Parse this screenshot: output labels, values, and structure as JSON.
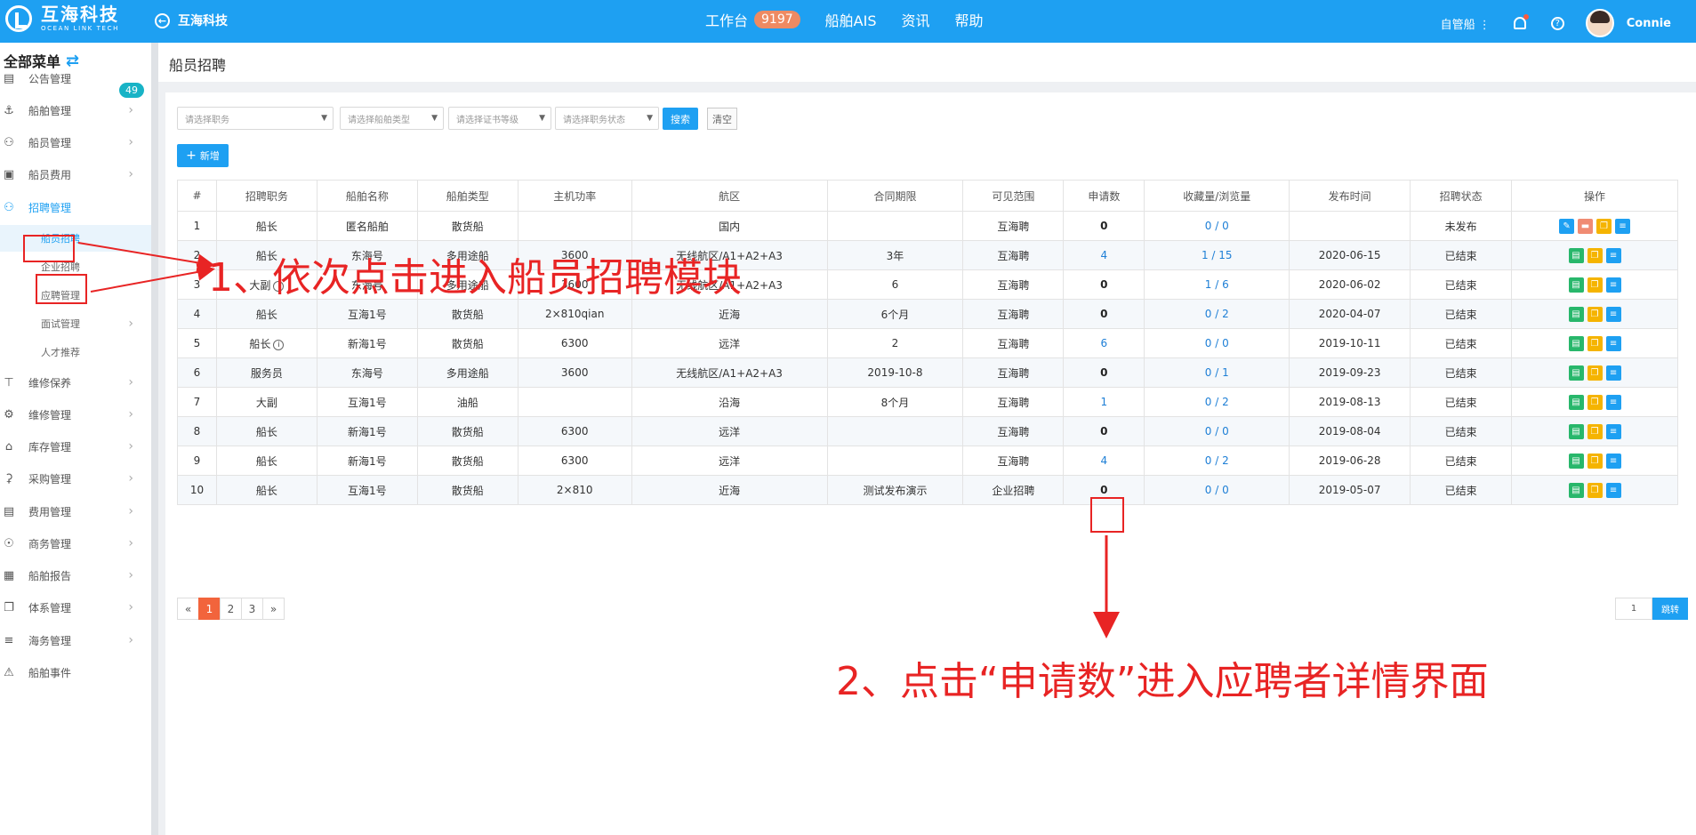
{
  "topbar": {
    "logo_cn": "互海科技",
    "logo_en": "OCEAN LINK TECH",
    "back_label": "互海科技",
    "nav": [
      {
        "label": "工作台",
        "badge": "9197"
      },
      {
        "label": "船舶AIS"
      },
      {
        "label": "资讯"
      },
      {
        "label": "帮助"
      }
    ],
    "owner_label": "自管船",
    "username": "Connie"
  },
  "sidebar": {
    "title": "全部菜单",
    "notice_badge": "49",
    "items": [
      {
        "label": "公告管理",
        "icon": "book-icon"
      },
      {
        "label": "船舶管理",
        "icon": "anchor-icon"
      },
      {
        "label": "船员管理",
        "icon": "user-icon"
      },
      {
        "label": "船员费用",
        "icon": "wallet-icon"
      },
      {
        "label": "招聘管理",
        "icon": "recruit-icon"
      },
      {
        "label": "维修保养",
        "icon": "wrench-icon"
      },
      {
        "label": "维修管理",
        "icon": "spanner-icon"
      },
      {
        "label": "库存管理",
        "icon": "warehouse-icon"
      },
      {
        "label": "采购管理",
        "icon": "cart-icon"
      },
      {
        "label": "费用管理",
        "icon": "coins-icon"
      },
      {
        "label": "商务管理",
        "icon": "globe-icon"
      },
      {
        "label": "船舶报告",
        "icon": "report-icon"
      },
      {
        "label": "体系管理",
        "icon": "copy-icon"
      },
      {
        "label": "海务管理",
        "icon": "sea-icon"
      },
      {
        "label": "船舶事件",
        "icon": "warning-icon"
      }
    ],
    "sub_items": [
      {
        "label": "船员招聘"
      },
      {
        "label": "企业招聘"
      },
      {
        "label": "应聘管理"
      },
      {
        "label": "面试管理"
      },
      {
        "label": "人才推荐"
      }
    ]
  },
  "page": {
    "title": "船员招聘"
  },
  "filters": {
    "position_placeholder": "请选择职务",
    "ship_type_placeholder": "请选择船舶类型",
    "cert_placeholder": "请选择证书等级",
    "status_placeholder": "请选择职务状态",
    "search_label": "搜索",
    "clear_label": "清空",
    "add_label": "新增"
  },
  "table": {
    "headers": [
      "#",
      "招聘职务",
      "船舶名称",
      "船舶类型",
      "主机功率",
      "航区",
      "合同期限",
      "可见范围",
      "申请数",
      "收藏量/浏览量",
      "发布时间",
      "招聘状态",
      "操作"
    ],
    "rows": [
      {
        "no": "1",
        "position": "船长",
        "ship": "匿名船舶",
        "type": "散货船",
        "power": "",
        "area": "国内",
        "term": "",
        "scope": "互海聘",
        "apps": "0",
        "views": "0 / 0",
        "date": "",
        "status": "未发布"
      },
      {
        "no": "2",
        "position": "船长",
        "ship": "东海号",
        "type": "多用途船",
        "power": "3600",
        "area": "无线航区/A1+A2+A3",
        "term": "3年",
        "scope": "互海聘",
        "apps": "4",
        "views": "1 / 15",
        "date": "2020-06-15",
        "status": "已结束"
      },
      {
        "no": "3",
        "position": "大副",
        "ship": "东海号",
        "type": "多用途船",
        "power": "3600",
        "area": "无线航区/A1+A2+A3",
        "term": "6",
        "scope": "互海聘",
        "apps": "0",
        "views": "1 / 6",
        "date": "2020-06-02",
        "status": "已结束"
      },
      {
        "no": "4",
        "position": "船长",
        "ship": "互海1号",
        "type": "散货船",
        "power": "2×810qian",
        "area": "近海",
        "term": "6个月",
        "scope": "互海聘",
        "apps": "0",
        "views": "0 / 2",
        "date": "2020-04-07",
        "status": "已结束"
      },
      {
        "no": "5",
        "position": "船长",
        "ship": "新海1号",
        "type": "散货船",
        "power": "6300",
        "area": "远洋",
        "term": "2",
        "scope": "互海聘",
        "apps": "6",
        "views": "0 / 0",
        "date": "2019-10-11",
        "status": "已结束"
      },
      {
        "no": "6",
        "position": "服务员",
        "ship": "东海号",
        "type": "多用途船",
        "power": "3600",
        "area": "无线航区/A1+A2+A3",
        "term": "2019-10-8",
        "scope": "互海聘",
        "apps": "0",
        "views": "0 / 1",
        "date": "2019-09-23",
        "status": "已结束"
      },
      {
        "no": "7",
        "position": "大副",
        "ship": "互海1号",
        "type": "油船",
        "power": "",
        "area": "沿海",
        "term": "8个月",
        "scope": "互海聘",
        "apps": "1",
        "views": "0 / 2",
        "date": "2019-08-13",
        "status": "已结束"
      },
      {
        "no": "8",
        "position": "船长",
        "ship": "新海1号",
        "type": "散货船",
        "power": "6300",
        "area": "远洋",
        "term": "",
        "scope": "互海聘",
        "apps": "0",
        "views": "0 / 0",
        "date": "2019-08-04",
        "status": "已结束"
      },
      {
        "no": "9",
        "position": "船长",
        "ship": "新海1号",
        "type": "散货船",
        "power": "6300",
        "area": "远洋",
        "term": "",
        "scope": "互海聘",
        "apps": "4",
        "views": "0 / 2",
        "date": "2019-06-28",
        "status": "已结束"
      },
      {
        "no": "10",
        "position": "船长",
        "ship": "互海1号",
        "type": "散货船",
        "power": "2×810",
        "area": "近海",
        "term": "测试发布演示",
        "scope": "企业招聘",
        "apps": "0",
        "views": "0 / 0",
        "date": "2019-05-07",
        "status": "已结束"
      }
    ]
  },
  "pagination": {
    "prev": "«",
    "pages": [
      "1",
      "2",
      "3"
    ],
    "next": "»",
    "goto_value": "1",
    "goto_label": "跳转"
  },
  "annotations": {
    "step1": "1、依次点击进入船员招聘模块",
    "step2": "2、点击“申请数”进入应聘者详情界面",
    "color": "#e82424"
  }
}
